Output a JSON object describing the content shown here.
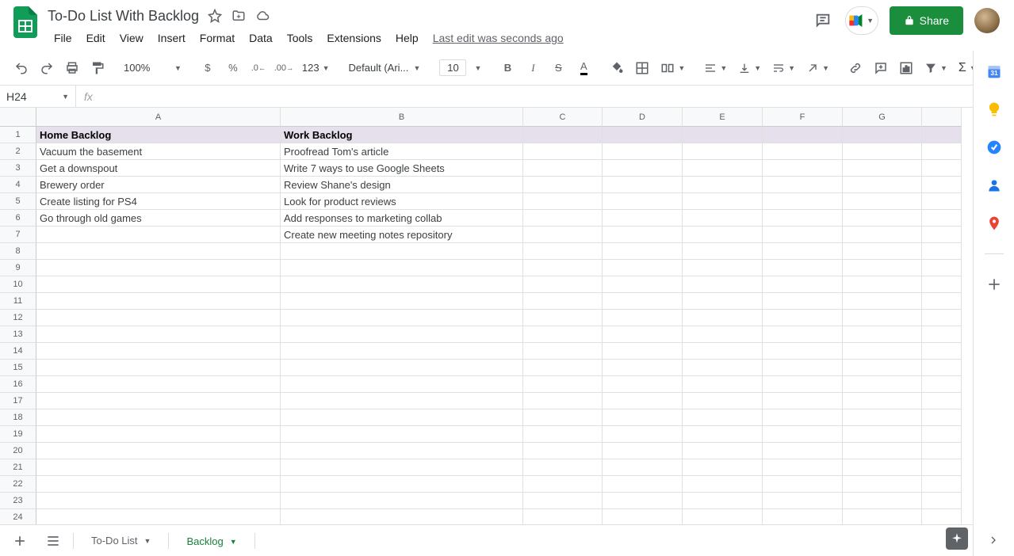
{
  "doc": {
    "title": "To-Do List With Backlog",
    "last_edit": "Last edit was seconds ago"
  },
  "menu": {
    "file": "File",
    "edit": "Edit",
    "view": "View",
    "insert": "Insert",
    "format": "Format",
    "data": "Data",
    "tools": "Tools",
    "extensions": "Extensions",
    "help": "Help"
  },
  "toolbar": {
    "zoom": "100%",
    "font": "Default (Ari...",
    "size": "10",
    "currency": "$",
    "percent": "%",
    "dec_dec": ".0",
    "inc_dec": ".00",
    "more_fmt": "123"
  },
  "share": {
    "label": "Share"
  },
  "name_box": {
    "value": "H24"
  },
  "columns": [
    "A",
    "B",
    "C",
    "D",
    "E",
    "F",
    "G",
    ""
  ],
  "rows": {
    "count": 24,
    "data": [
      {
        "a": "Home Backlog",
        "b": "Work Backlog",
        "header": true
      },
      {
        "a": "Vacuum the basement",
        "b": "Proofread Tom's article"
      },
      {
        "a": "Get a downspout",
        "b": "Write 7 ways to use Google Sheets"
      },
      {
        "a": "Brewery order",
        "b": "Review Shane's design"
      },
      {
        "a": "Create listing for PS4",
        "b": "Look for product reviews"
      },
      {
        "a": "Go through old games",
        "b": "Add responses to marketing collab"
      },
      {
        "a": "",
        "b": "Create new meeting notes repository"
      }
    ]
  },
  "tabs": {
    "todo": "To-Do List",
    "backlog": "Backlog"
  }
}
